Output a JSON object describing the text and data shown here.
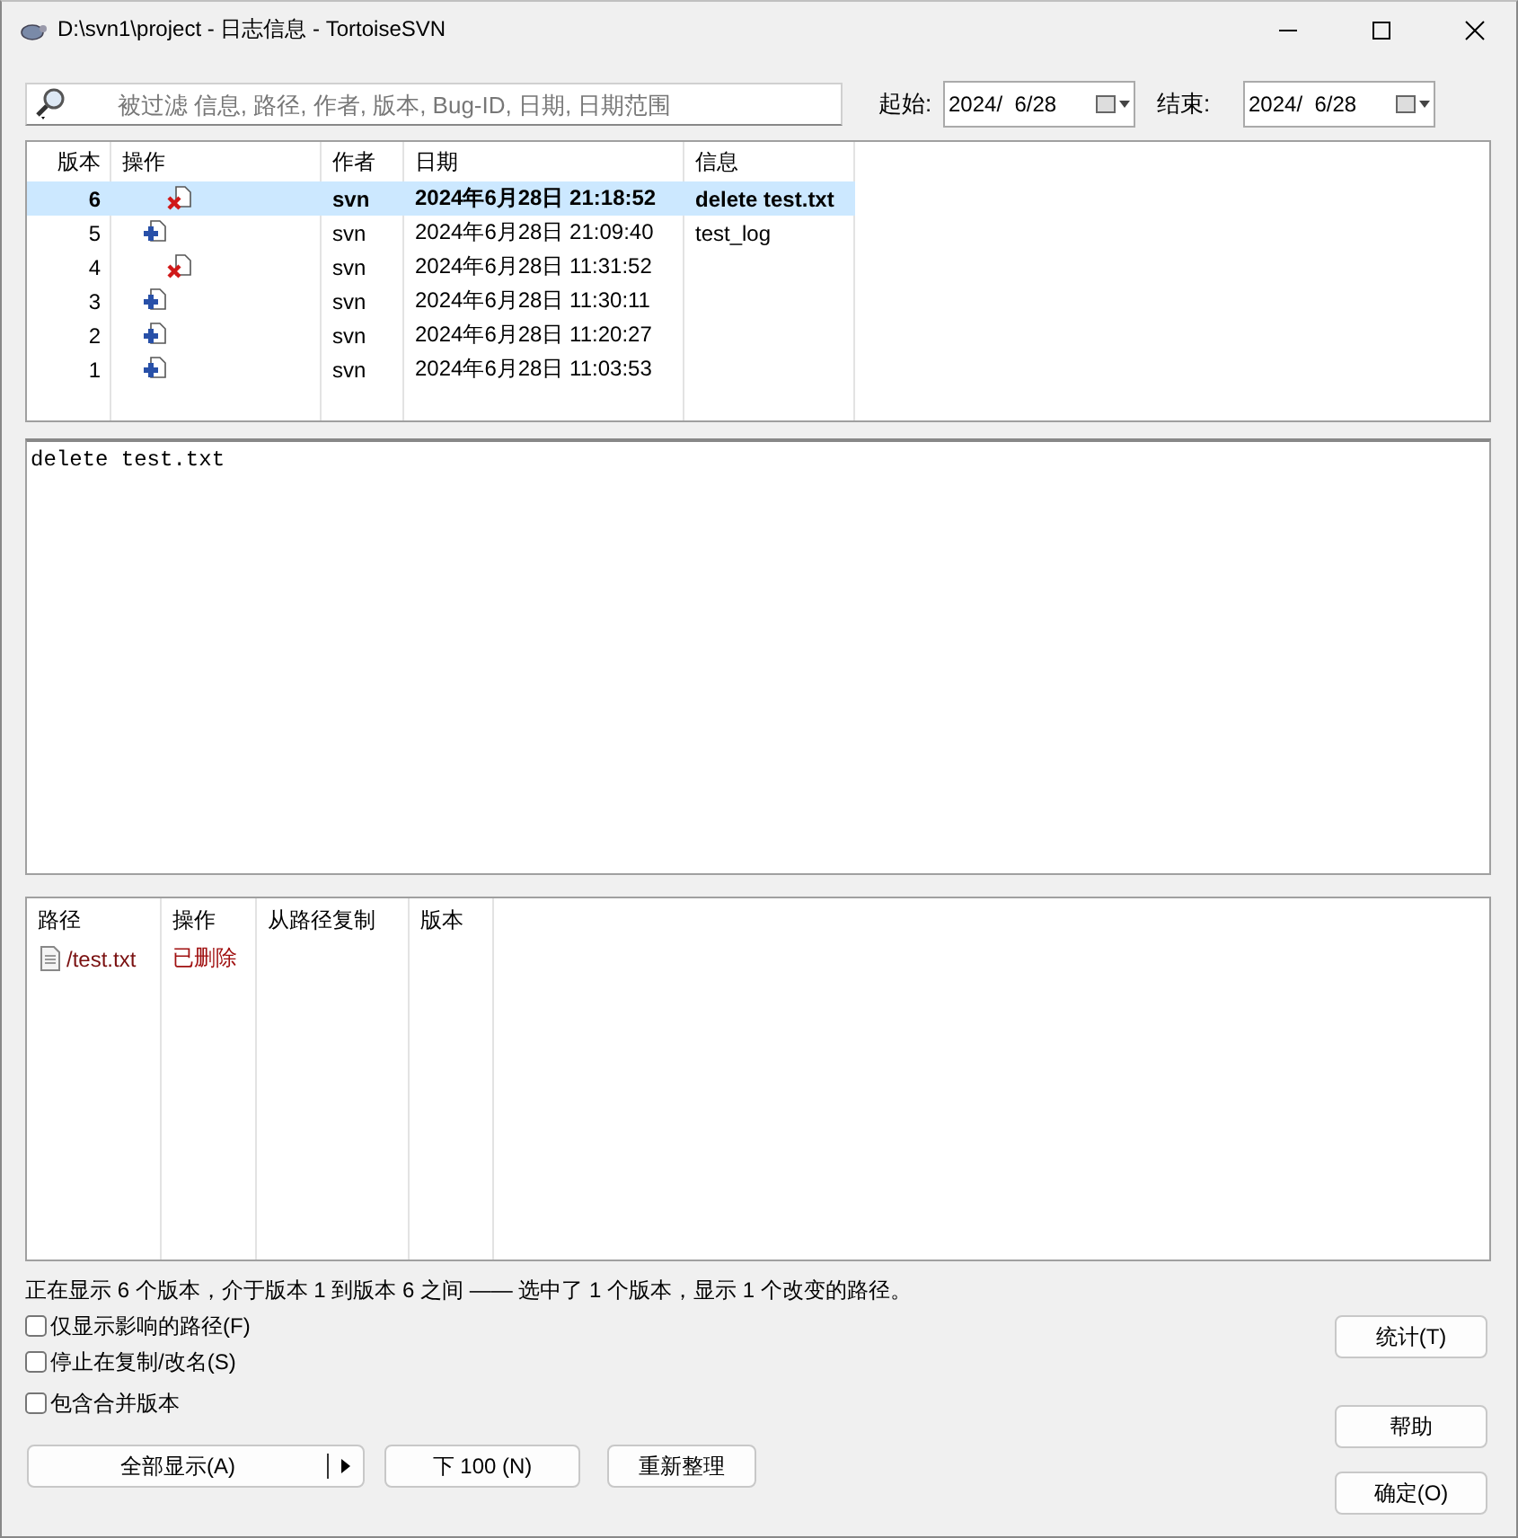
{
  "window": {
    "title": "D:\\svn1\\project - 日志信息 - TortoiseSVN"
  },
  "filter": {
    "placeholder": "被过滤 信息, 路径, 作者, 版本, Bug-ID, 日期, 日期范围"
  },
  "date_from": {
    "label": "起始:",
    "value": "2024/  6/28"
  },
  "date_to": {
    "label": "结束:",
    "value": "2024/  6/28"
  },
  "revisions": {
    "columns": [
      "版本",
      "操作",
      "作者",
      "日期",
      "信息"
    ],
    "rows": [
      {
        "revision": "6",
        "kind": "delete",
        "author": "svn",
        "date": "2024年6月28日 21:18:52",
        "message": "delete test.txt",
        "selected": true
      },
      {
        "revision": "5",
        "kind": "add",
        "author": "svn",
        "date": "2024年6月28日 21:09:40",
        "message": "test_log",
        "selected": false
      },
      {
        "revision": "4",
        "kind": "delete",
        "author": "svn",
        "date": "2024年6月28日 11:31:52",
        "selected": false
      },
      {
        "revision": "3",
        "kind": "add",
        "author": "svn",
        "date": "2024年6月28日 11:30:11",
        "selected": false
      },
      {
        "revision": "2",
        "kind": "add",
        "author": "svn",
        "date": "2024年6月28日 11:20:27",
        "selected": false
      },
      {
        "revision": "1",
        "kind": "add",
        "author": "svn",
        "date": "2024年6月28日 11:03:53",
        "selected": false
      }
    ]
  },
  "message_text": "delete test.txt",
  "paths": {
    "columns": [
      "路径",
      "操作",
      "从路径复制",
      "版本"
    ],
    "rows": [
      {
        "path": "/test.txt",
        "action": "已删除"
      }
    ]
  },
  "status": "正在显示 6 个版本，介于版本 1 到版本 6 之间 —— 选中了 1 个版本，显示 1 个改变的路径。",
  "options": [
    {
      "label": "仅显示影响的路径(F)",
      "checked": false
    },
    {
      "label": "停止在复制/改名(S)",
      "checked": false
    },
    {
      "label": "包含合并版本",
      "checked": false
    }
  ],
  "side_buttons": [
    "统计(T)",
    "帮助",
    "确定(O)"
  ],
  "bottom_buttons": [
    {
      "label": "全部显示(A)",
      "kind": "split"
    },
    {
      "label": "下 100 (N)",
      "kind": "plain"
    },
    {
      "label": "重新整理",
      "kind": "plain"
    }
  ]
}
